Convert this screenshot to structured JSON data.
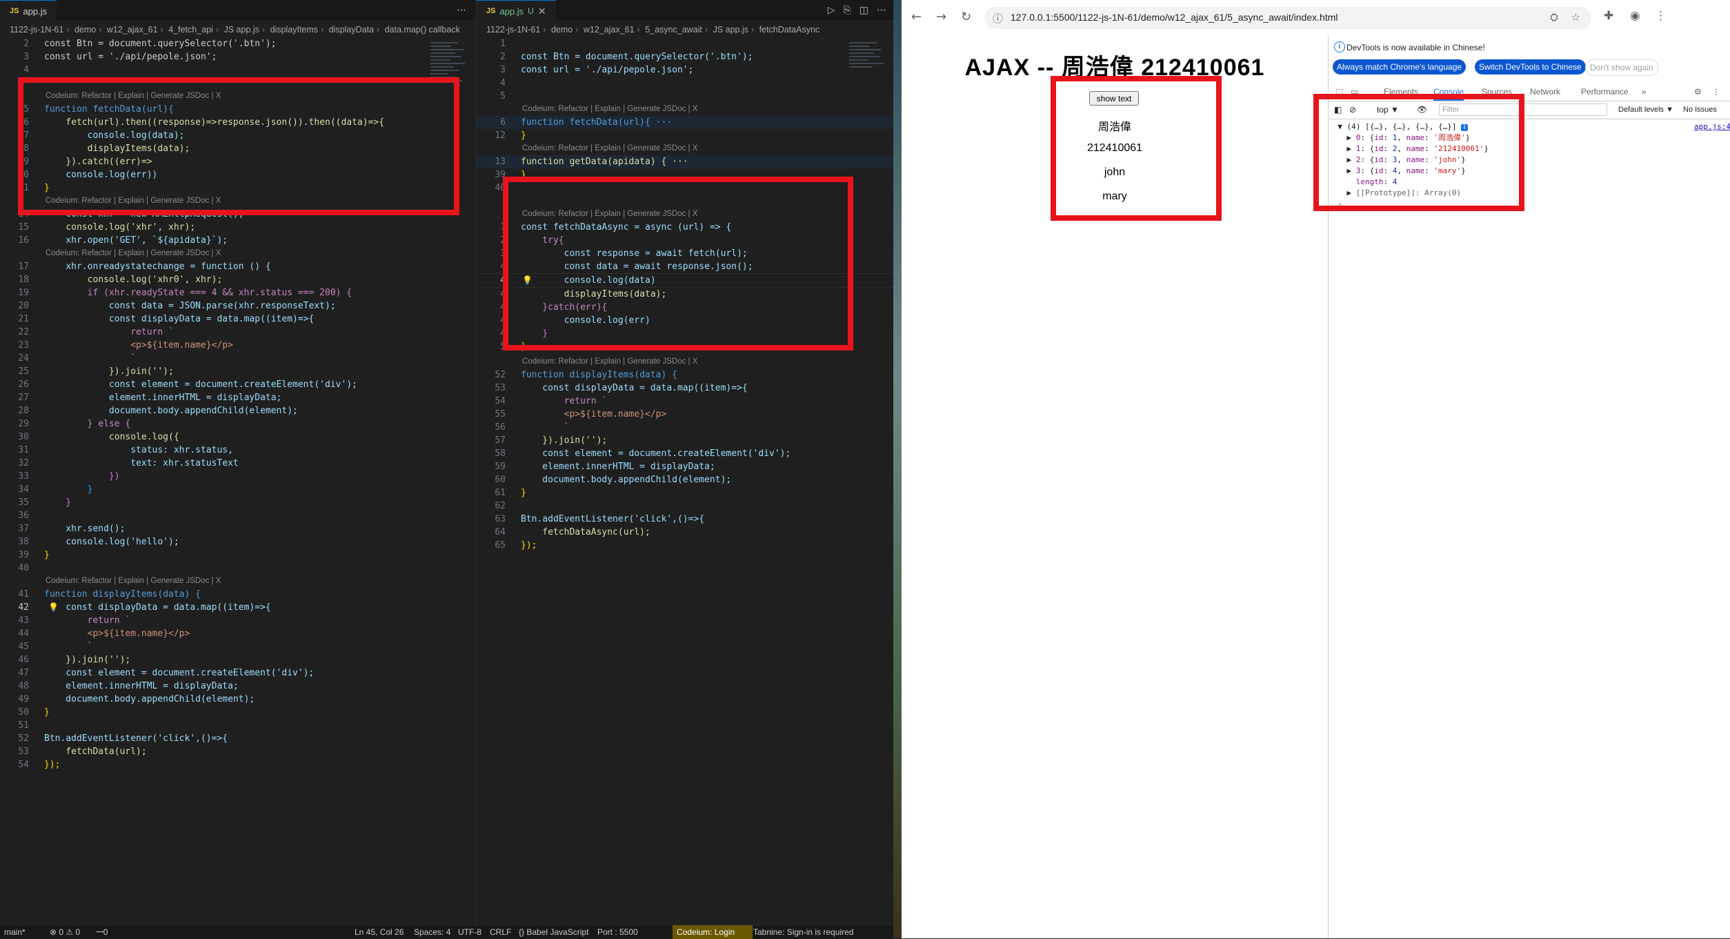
{
  "vscode": {
    "left": {
      "tab": {
        "badge": "JS",
        "label": "app.js"
      },
      "breadcrumb": [
        "1122-js-1N-61",
        "demo",
        "w12_ajax_61",
        "4_fetch_api",
        "JS app.js",
        "displayItems",
        "displayData",
        "data.map() callback"
      ],
      "lens": "Codeium: Refactor | Explain | Generate JSDoc | X",
      "lines": [
        [
          "2",
          "const Btn = document.querySelector('.btn');"
        ],
        [
          "3",
          "const url = './api/pepole.json';"
        ],
        [
          "4",
          ""
        ],
        [
          "5",
          "function fetchData(url){"
        ],
        [
          "6",
          "    fetch(url).then((response)=>response.json()).then((data)=>{"
        ],
        [
          "7",
          "        console.log(data);"
        ],
        [
          "8",
          "        displayItems(data);"
        ],
        [
          "9",
          "    }).catch((err)=>"
        ],
        [
          "10",
          "    console.log(err))"
        ],
        [
          "11",
          "}"
        ],
        [
          "14",
          "    const xhr = new XMLHttpRequest();"
        ],
        [
          "15",
          "    console.log('xhr', xhr);"
        ],
        [
          "16",
          "    xhr.open('GET', `${apidata}`);"
        ],
        [
          "17",
          "    xhr.onreadystatechange = function () {"
        ],
        [
          "18",
          "        console.log('xhr0', xhr);"
        ],
        [
          "19",
          "        if (xhr.readyState === 4 && xhr.status === 200) {"
        ],
        [
          "20",
          "            const data = JSON.parse(xhr.responseText);"
        ],
        [
          "21",
          "            const displayData = data.map((item)=>{"
        ],
        [
          "22",
          "                return `"
        ],
        [
          "23",
          "                <p>${item.name}</p>"
        ],
        [
          "24",
          "                `"
        ],
        [
          "25",
          "            }).join('');"
        ],
        [
          "26",
          "            const element = document.createElement('div');"
        ],
        [
          "27",
          "            element.innerHTML = displayData;"
        ],
        [
          "28",
          "            document.body.appendChild(element);"
        ],
        [
          "29",
          "        } else {"
        ],
        [
          "30",
          "            console.log({"
        ],
        [
          "31",
          "                status: xhr.status,"
        ],
        [
          "32",
          "                text: xhr.statusText"
        ],
        [
          "33",
          "            })"
        ],
        [
          "34",
          "        }"
        ],
        [
          "35",
          "    }"
        ],
        [
          "36",
          ""
        ],
        [
          "37",
          "    xhr.send();"
        ],
        [
          "38",
          "    console.log('hello');"
        ],
        [
          "39",
          "}"
        ],
        [
          "40",
          ""
        ],
        [
          "41",
          "function displayItems(data) {"
        ],
        [
          "42",
          "    const displayData = data.map((item)=>{"
        ],
        [
          "43",
          "        return `"
        ],
        [
          "44",
          "        <p>${item.name}</p>"
        ],
        [
          "45",
          "        `"
        ],
        [
          "46",
          "    }).join('');"
        ],
        [
          "47",
          "    const element = document.createElement('div');"
        ],
        [
          "48",
          "    element.innerHTML = displayData;"
        ],
        [
          "49",
          "    document.body.appendChild(element);"
        ],
        [
          "50",
          "}"
        ],
        [
          "51",
          ""
        ],
        [
          "52",
          "Btn.addEventListener('click',()=>{"
        ],
        [
          "53",
          "    fetchData(url);"
        ],
        [
          "54",
          "});"
        ]
      ]
    },
    "right": {
      "tab": {
        "badge": "JS",
        "label": "app.js",
        "modified": "U"
      },
      "breadcrumb": [
        "1122-js-1N-61",
        "demo",
        "w12_ajax_61",
        "5_async_await",
        "JS app.js",
        "fetchDataAsync"
      ],
      "lens": "Codeium: Refactor | Explain | Generate JSDoc | X",
      "lines": [
        [
          "1",
          ""
        ],
        [
          "2",
          "const Btn = document.querySelector('.btn');"
        ],
        [
          "3",
          "const url = './api/pepole.json';"
        ],
        [
          "4",
          ""
        ],
        [
          "5",
          ""
        ],
        [
          "6",
          "function fetchData(url){ ···"
        ],
        [
          "12",
          "}"
        ],
        [
          "13",
          "function getData(apidata) { ···"
        ],
        [
          "39",
          "}"
        ],
        [
          "40",
          ""
        ],
        [
          "1",
          "const fetchDataAsync = async (url) => {"
        ],
        [
          "2",
          "    try{"
        ],
        [
          "3",
          "        const response = await fetch(url);"
        ],
        [
          "4",
          "        const data = await response.json();"
        ],
        [
          "4",
          "        console.log(data)"
        ],
        [
          "4",
          "        displayItems(data);"
        ],
        [
          "4",
          "    }catch(err){"
        ],
        [
          "4",
          "        console.log(err)"
        ],
        [
          "4",
          "    }"
        ],
        [
          "5",
          "}"
        ],
        [
          "52",
          "function displayItems(data) {"
        ],
        [
          "53",
          "    const displayData = data.map((item)=>{"
        ],
        [
          "54",
          "        return `"
        ],
        [
          "55",
          "        <p>${item.name}</p>"
        ],
        [
          "56",
          "        `"
        ],
        [
          "57",
          "    }).join('');"
        ],
        [
          "58",
          "    const element = document.createElement('div');"
        ],
        [
          "59",
          "    element.innerHTML = displayData;"
        ],
        [
          "60",
          "    document.body.appendChild(element);"
        ],
        [
          "61",
          "}"
        ],
        [
          "62",
          ""
        ],
        [
          "63",
          "Btn.addEventListener('click',()=>{"
        ],
        [
          "64",
          "    fetchDataAsync(url);"
        ],
        [
          "65",
          "});"
        ]
      ]
    },
    "status": {
      "branch": "main*",
      "errors": "⊗ 0 ⚠ 0",
      "ports": "ꟷ0",
      "position": "Ln 45, Col 26",
      "spaces": "Spaces: 4",
      "encoding": "UTF-8",
      "eol": "CRLF",
      "language": "{} Babel JavaScript",
      "port": "Port : 5500",
      "codeium": "Codeium: Login",
      "tabnine": "Tabnine: Sign-in is required"
    }
  },
  "browser": {
    "url": "127.0.0.1:5500/1122-js-1N-61/demo/w12_ajax_61/5_async_await/index.html",
    "page": {
      "title": "AJAX -- 周浩偉 212410061",
      "button": "show text",
      "items": [
        "周浩偉",
        "212410061",
        "john",
        "mary"
      ]
    },
    "devtools": {
      "notice": "DevTools is now available in Chinese!",
      "btn_match": "Always match Chrome's language",
      "btn_switch": "Switch DevTools to Chinese",
      "btn_dismiss": "Don't show again",
      "tabs": [
        "Elements",
        "Console",
        "Sources",
        "Network",
        "Performance",
        "»"
      ],
      "context": "top ▼",
      "filter_placeholder": "Filter",
      "levels": "Default levels ▼",
      "issues": "No Issues",
      "source_link": "app.js:4",
      "log": {
        "summary": "(4) [{…}, {…}, {…}, {…}]",
        "rows": [
          {
            "idx": "0",
            "id": "1",
            "name": "'周浩偉'"
          },
          {
            "idx": "1",
            "id": "2",
            "name": "'212410061'"
          },
          {
            "idx": "2",
            "id": "3",
            "name": "'john'"
          },
          {
            "idx": "3",
            "id": "4",
            "name": "'mary'"
          }
        ],
        "length": "4",
        "proto": "[[Prototype]]: Array(0)"
      }
    }
  }
}
